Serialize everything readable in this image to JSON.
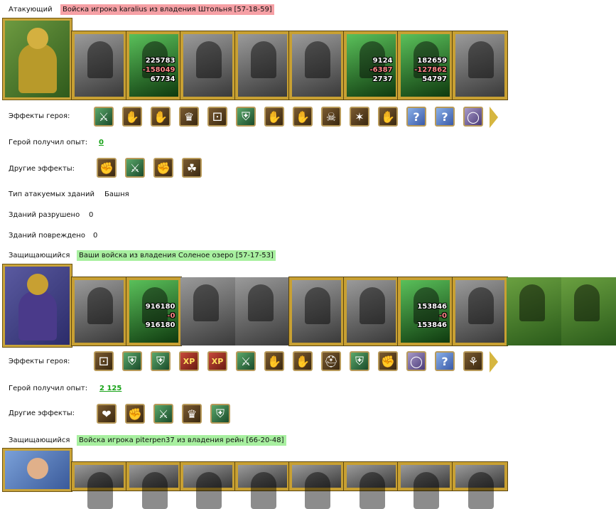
{
  "labels": {
    "attacker": "Атакующий",
    "defender": "Защищающийся",
    "hero_effects": "Эффекты героя:",
    "hero_xp": "Герой получил опыт:",
    "other_effects": "Другие эффекты:",
    "target_buildings": "Тип атакуемых зданий",
    "destroyed": "Зданий разрушено",
    "damaged": "Зданий повреждено"
  },
  "attacker": {
    "title": "Войска игрока karalius из владения Штольня [57-18-59]",
    "units": [
      {
        "kind": "gray"
      },
      {
        "kind": "green",
        "nums": [
          "225783",
          "-158049",
          "67734"
        ]
      },
      {
        "kind": "gray"
      },
      {
        "kind": "gray"
      },
      {
        "kind": "gray"
      },
      {
        "kind": "green",
        "nums": [
          "9124",
          "-6387",
          "2737"
        ]
      },
      {
        "kind": "green",
        "nums": [
          "182659",
          "-127862",
          "54797"
        ]
      },
      {
        "kind": "gray"
      }
    ],
    "hero_effects": [
      "⚔",
      "✋",
      "✋",
      "♛",
      "⚀",
      "⛨",
      "✋",
      "✋",
      "☠",
      "✶",
      "✋",
      "?",
      "?",
      "◯"
    ],
    "xp": "0",
    "other_effects": [
      "✊",
      "⚔",
      "✊",
      "☘"
    ],
    "building_type": "Башня",
    "destroyed": "0",
    "damaged": "0"
  },
  "defender1": {
    "title": "Ваши войска из владения Соленое озеро [57-17-53]",
    "units": [
      {
        "kind": "gray"
      },
      {
        "kind": "green",
        "nums": [
          "916180",
          "-0",
          "916180"
        ]
      },
      {
        "kind": "gray",
        "plain": true
      },
      {
        "kind": "gray",
        "plain": true
      },
      {
        "kind": "gray"
      },
      {
        "kind": "gray"
      },
      {
        "kind": "green",
        "nums": [
          "153846",
          "-0",
          "153846"
        ]
      },
      {
        "kind": "gray"
      },
      {
        "kind": "build",
        "plain": true
      },
      {
        "kind": "build",
        "plain": true
      }
    ],
    "hero_effects": [
      "⚀",
      "⛨",
      "⛨",
      "XP",
      "XP",
      "⚔",
      "✋",
      "✋",
      "⛑",
      "⛨",
      "✊",
      "◯",
      "?",
      "⚘"
    ],
    "xp": "2 125",
    "other_effects": [
      "❤",
      "✊",
      "⚔",
      "♛",
      "⛨"
    ]
  },
  "defender2": {
    "title": "Войска игрока piterpen37 из владения рейн [66-20-48]",
    "units": [
      {
        "kind": "gray"
      },
      {
        "kind": "gray"
      },
      {
        "kind": "gray"
      },
      {
        "kind": "gray"
      },
      {
        "kind": "gray"
      },
      {
        "kind": "gray"
      },
      {
        "kind": "gray"
      },
      {
        "kind": "gray"
      }
    ]
  }
}
